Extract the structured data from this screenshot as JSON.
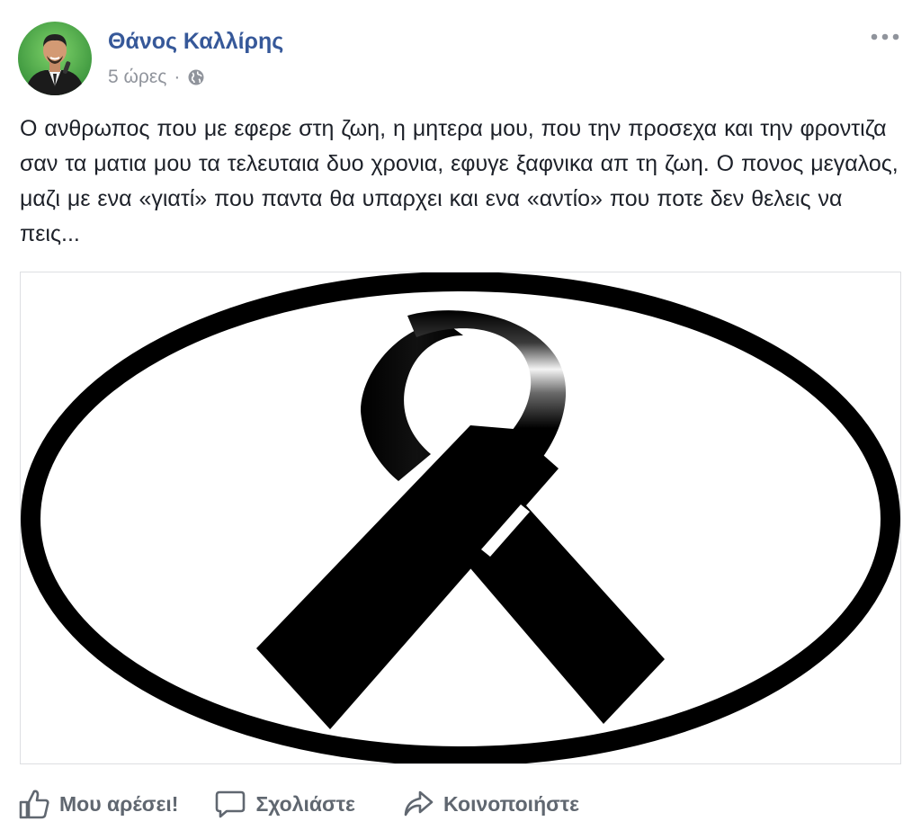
{
  "post": {
    "author": "Θάνος Καλλίρης",
    "time": "5 ώρες",
    "separator": "·",
    "privacy_icon": "globe-icon",
    "more_icon": "more-options-icon",
    "text": "Ο ανθρωπος που με εφερε στη ζωη, η μητερα μου, που την προσεχα και την φροντιζα σαν τα ματια μου τα τελευταια δυο χρονια, εφυγε ξαφνικα απ τη ζωη. Ο πονος μεγαλος, μαζι με ενα «γιατί» που παντα θα υπαρχει και ενα «αντίο» που ποτε δεν θελεις να πεις..."
  },
  "image": {
    "subject": "black-mourning-ribbon-in-oval"
  },
  "actions": {
    "like": "Μου αρέσει!",
    "comment": "Σχολιάστε",
    "share": "Κοινοποιήστε"
  },
  "colors": {
    "author": "#365899",
    "meta": "#90949c",
    "text": "#1d2129",
    "action": "#606770",
    "border": "#dddfe2"
  }
}
